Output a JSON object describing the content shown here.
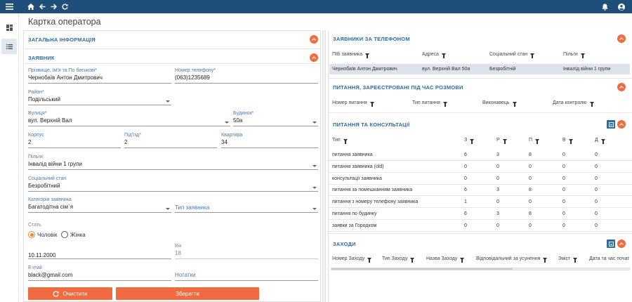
{
  "page_title": "Картка оператора",
  "accent_color": "#f26a3f",
  "topbar_color": "#1f4e79",
  "icons": {
    "menu": "menu-icon",
    "home": "home-icon",
    "back": "arrow-left-icon",
    "forward": "arrow-right-icon",
    "refresh": "refresh-icon",
    "bell": "bell-icon",
    "user": "account-icon",
    "dashboard": "dashboard-icon",
    "list": "list-icon",
    "collapse": "chevron-up-icon",
    "download": "download-icon"
  },
  "left": {
    "general_info_title": "ЗАГАЛЬНА ІНФОРМАЦІЯ",
    "applicant_title": "ЗАЯВНИК",
    "fields": {
      "name": {
        "label": "Прізвище, Ім'я та По батькові*",
        "value": "Чернобаїв Антон Дмитрович"
      },
      "phone": {
        "label": "Номер телефону*",
        "value": "(063)1235689"
      },
      "district": {
        "label": "Район*",
        "value": "Подільський"
      },
      "street": {
        "label": "Вулиця*",
        "value": "вул. Верхній Вал"
      },
      "building": {
        "label": "Будинок*",
        "value": "50а"
      },
      "korpus": {
        "label": "Корпус",
        "value": "2"
      },
      "entrance": {
        "label": "Під'їзд*",
        "value": "2"
      },
      "apartment": {
        "label": "Квартира",
        "value": "34"
      },
      "privileges": {
        "label": "Пільги",
        "value": "Інвалід війни 1 групи"
      },
      "social": {
        "label": "Соціальний стан",
        "value": "Безробітний"
      },
      "category": {
        "label": "Категорія заявника",
        "value": "Багатодітна сім`я"
      },
      "applicant_type": {
        "placeholder": "Тип заявника"
      },
      "sex": {
        "label": "Стать",
        "male": "Чоловік",
        "female": "Жінка",
        "selected": "male"
      },
      "birthdate": {
        "value": "10.11.2000"
      },
      "age": {
        "label": "Вік",
        "value": "18"
      },
      "email": {
        "label": "E-mail",
        "value": "black@gmail.com"
      },
      "notes": {
        "placeholder": "Нотатки"
      }
    },
    "clear_label": "Очистити",
    "save_label": "Зберегти"
  },
  "right": {
    "phone_applicants": {
      "title": "ЗАЯВНИКИ ЗА ТЕЛЕФОНОМ",
      "headers": [
        "ПІБ заявника",
        "Адреса",
        "Соціальний стан",
        "Пільги"
      ],
      "rows": [
        [
          "Чернобаїв Антон Дмитрович",
          "вул. Верхній Вал 50а",
          "Безробітній",
          "Інвалід війни 1 групи"
        ]
      ]
    },
    "call_questions": {
      "title": "ПИТАННЯ, ЗАРЕЄСТРОВАНІ ПІД ЧАС РОЗМОВИ",
      "headers": [
        "Номер питання",
        "Тип питання",
        "Виконавець",
        "Дата контролю"
      ]
    },
    "consultations": {
      "title": "ПИТАННЯ ТА КОНСУЛЬТАЦІЇ",
      "headers": [
        "Тип",
        "З",
        "Р",
        "П",
        "В",
        "Д"
      ],
      "rows": [
        [
          "питання заявника",
          "6",
          "3",
          "8",
          "0",
          "0"
        ],
        [
          "питання заявника (old)",
          "0",
          "0",
          "0",
          "0",
          "0"
        ],
        [
          "консультації заявника",
          "0",
          "0",
          "0",
          "0",
          "0"
        ],
        [
          "питання за помешканням заявника",
          "6",
          "3",
          "8",
          "0",
          "0"
        ],
        [
          "питання з номеру телефону заявника",
          "1",
          "0",
          "0",
          "0",
          "0"
        ],
        [
          "питання по будинку",
          "6",
          "3",
          "8",
          "0",
          "0"
        ],
        [
          "заявки за Городком",
          "0",
          "0",
          "0",
          "0",
          "0"
        ]
      ]
    },
    "events": {
      "title": "ЗАХОДИ",
      "headers": [
        "Номер Заходу",
        "Тип Заходу",
        "Назва Заходу",
        "Відповідальний за усунення",
        "Зміст",
        "Дата та час почат"
      ]
    }
  }
}
